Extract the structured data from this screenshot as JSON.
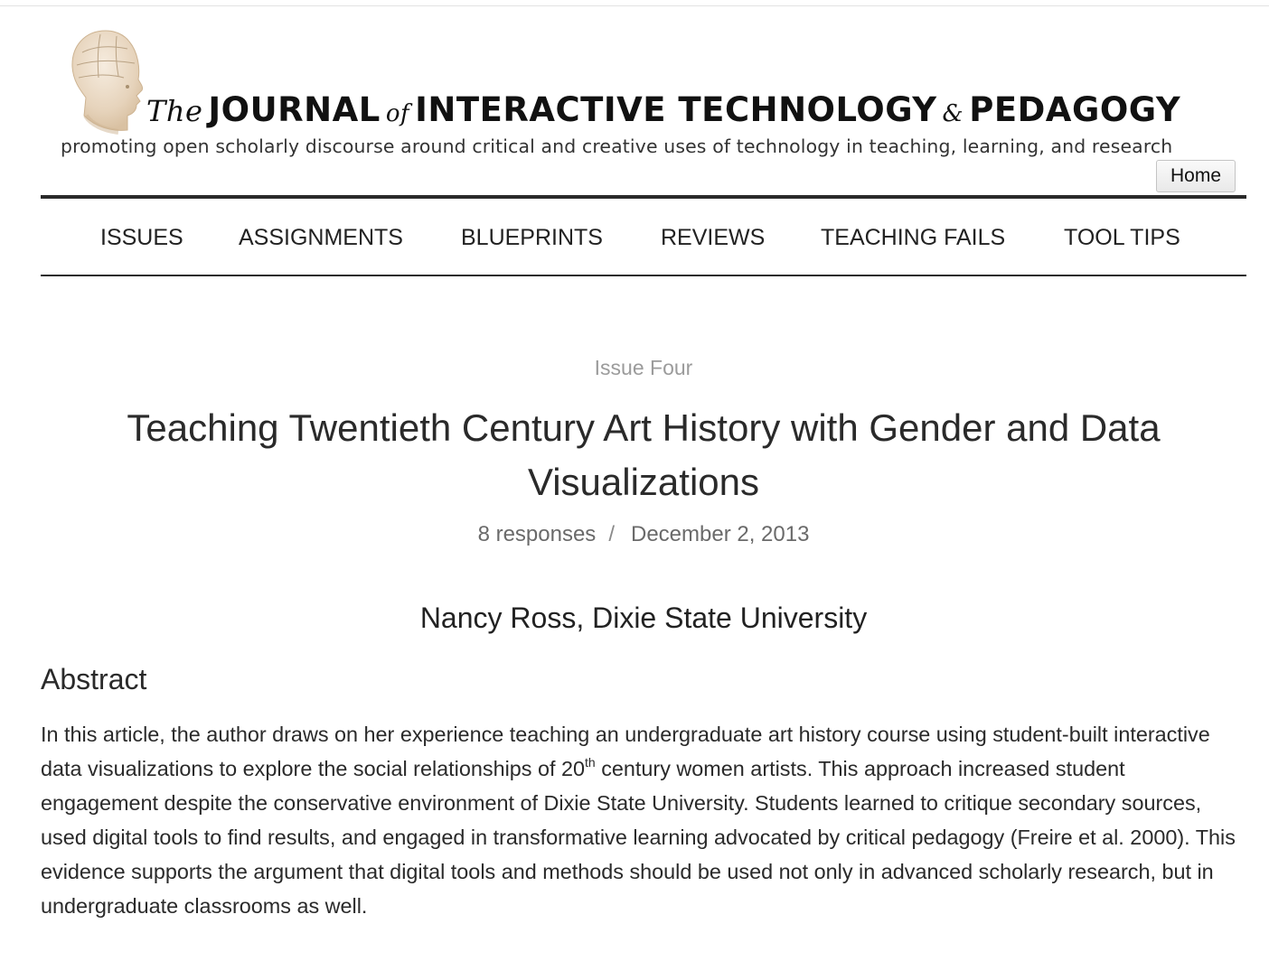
{
  "masthead": {
    "title_the": "The",
    "title_journal": "JOURNAL",
    "title_of": "of",
    "title_interactive": "INTERACTIVE TECHNOLOGY",
    "title_amp": "&",
    "title_pedagogy": "PEDAGOGY",
    "tagline": "promoting open scholarly discourse around critical and creative uses of technology in teaching, learning, and research",
    "logo_icon": "phrenology-head-icon",
    "home_label": "Home"
  },
  "nav": {
    "items": [
      {
        "label": "ISSUES"
      },
      {
        "label": "ASSIGNMENTS"
      },
      {
        "label": "BLUEPRINTS"
      },
      {
        "label": "REVIEWS"
      },
      {
        "label": "TEACHING FAILS"
      },
      {
        "label": "TOOL TIPS"
      }
    ]
  },
  "article": {
    "issue": "Issue Four",
    "title": "Teaching Twentieth Century Art History with Gender and Data Visualizations",
    "responses": "8 responses",
    "separator": "/",
    "date": "December 2, 2013",
    "author": "Nancy Ross, Dixie State University",
    "abstract_heading": "Abstract",
    "abstract_part1": "In this article, the author draws on her experience teaching an undergraduate art history course using student-built interactive data visualizations to explore the social relationships of 20",
    "abstract_sup": "th",
    "abstract_part2": " century women artists. This approach increased student engagement despite the conservative environment of Dixie State University. Students learned to critique secondary sources, used digital tools to find results, and engaged in transformative learning advocated by critical pedagogy (",
    "abstract_cite": "Freire et al. 2000",
    "abstract_part3": "). This evidence supports the argument that digital tools and methods should be used not only in advanced scholarly research, but in undergraduate classrooms as well."
  },
  "colors": {
    "rule": "#2a2a2a",
    "issue_label": "#9b9b9b",
    "meta": "#6a6a6a",
    "text": "#2a2a2a"
  }
}
